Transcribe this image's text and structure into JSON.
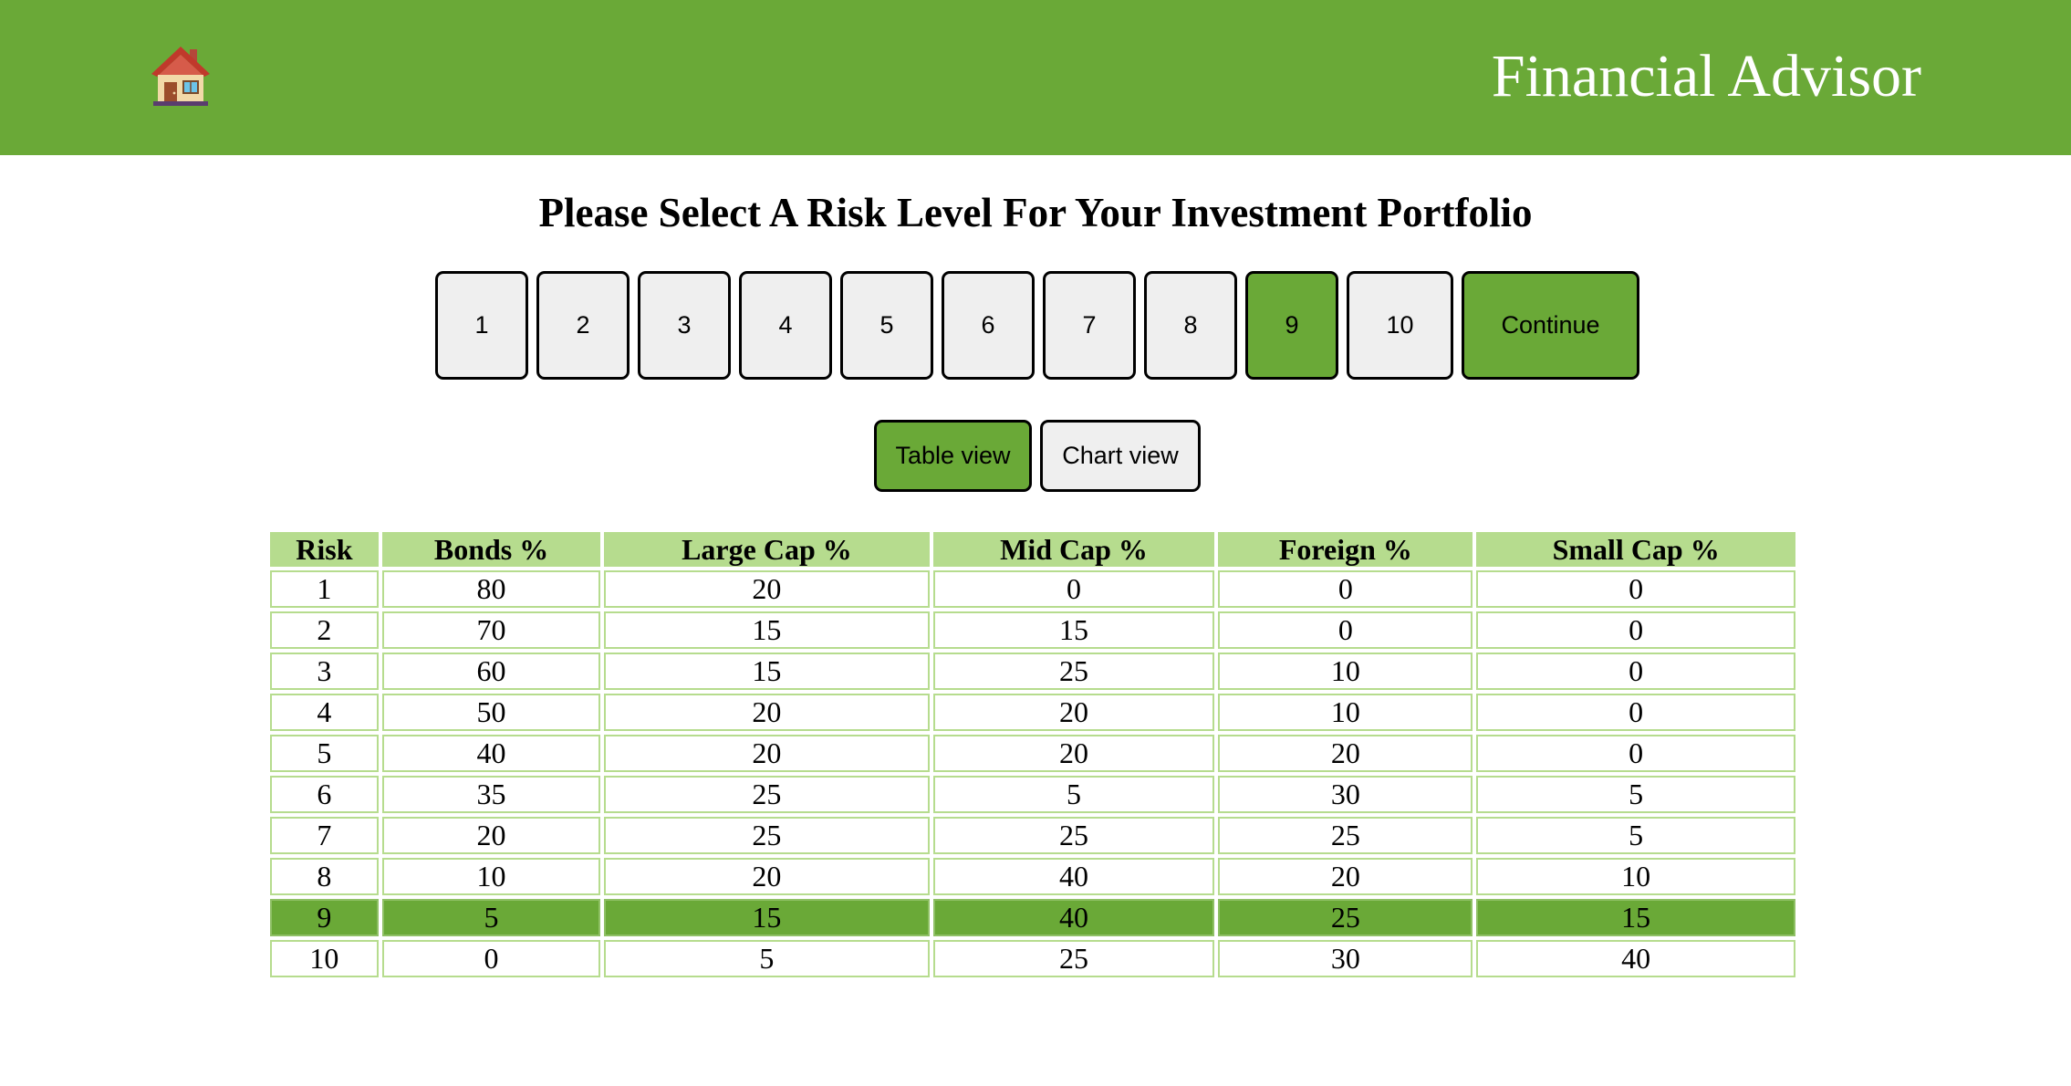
{
  "header": {
    "title": "Financial Advisor",
    "home_icon": "house-icon",
    "color": "#6aa937"
  },
  "heading": "Please Select A Risk Level For Your Investment Portfolio",
  "risk_buttons": [
    "1",
    "2",
    "3",
    "4",
    "5",
    "6",
    "7",
    "8",
    "9",
    "10"
  ],
  "selected_risk": "9",
  "continue_label": "Continue",
  "view_toggle": {
    "table_label": "Table view",
    "chart_label": "Chart view",
    "active": "Table view"
  },
  "table": {
    "headers": [
      "Risk",
      "Bonds %",
      "Large Cap %",
      "Mid Cap %",
      "Foreign %",
      "Small Cap %"
    ],
    "rows": [
      [
        "1",
        "80",
        "20",
        "0",
        "0",
        "0"
      ],
      [
        "2",
        "70",
        "15",
        "15",
        "0",
        "0"
      ],
      [
        "3",
        "60",
        "15",
        "25",
        "10",
        "0"
      ],
      [
        "4",
        "50",
        "20",
        "20",
        "10",
        "0"
      ],
      [
        "5",
        "40",
        "20",
        "20",
        "20",
        "0"
      ],
      [
        "6",
        "35",
        "25",
        "5",
        "30",
        "5"
      ],
      [
        "7",
        "20",
        "25",
        "25",
        "25",
        "5"
      ],
      [
        "8",
        "10",
        "20",
        "40",
        "20",
        "10"
      ],
      [
        "9",
        "5",
        "15",
        "40",
        "25",
        "15"
      ],
      [
        "10",
        "0",
        "5",
        "25",
        "30",
        "40"
      ]
    ],
    "highlight_color": "#6aa937",
    "header_color": "#b6dc8e"
  }
}
